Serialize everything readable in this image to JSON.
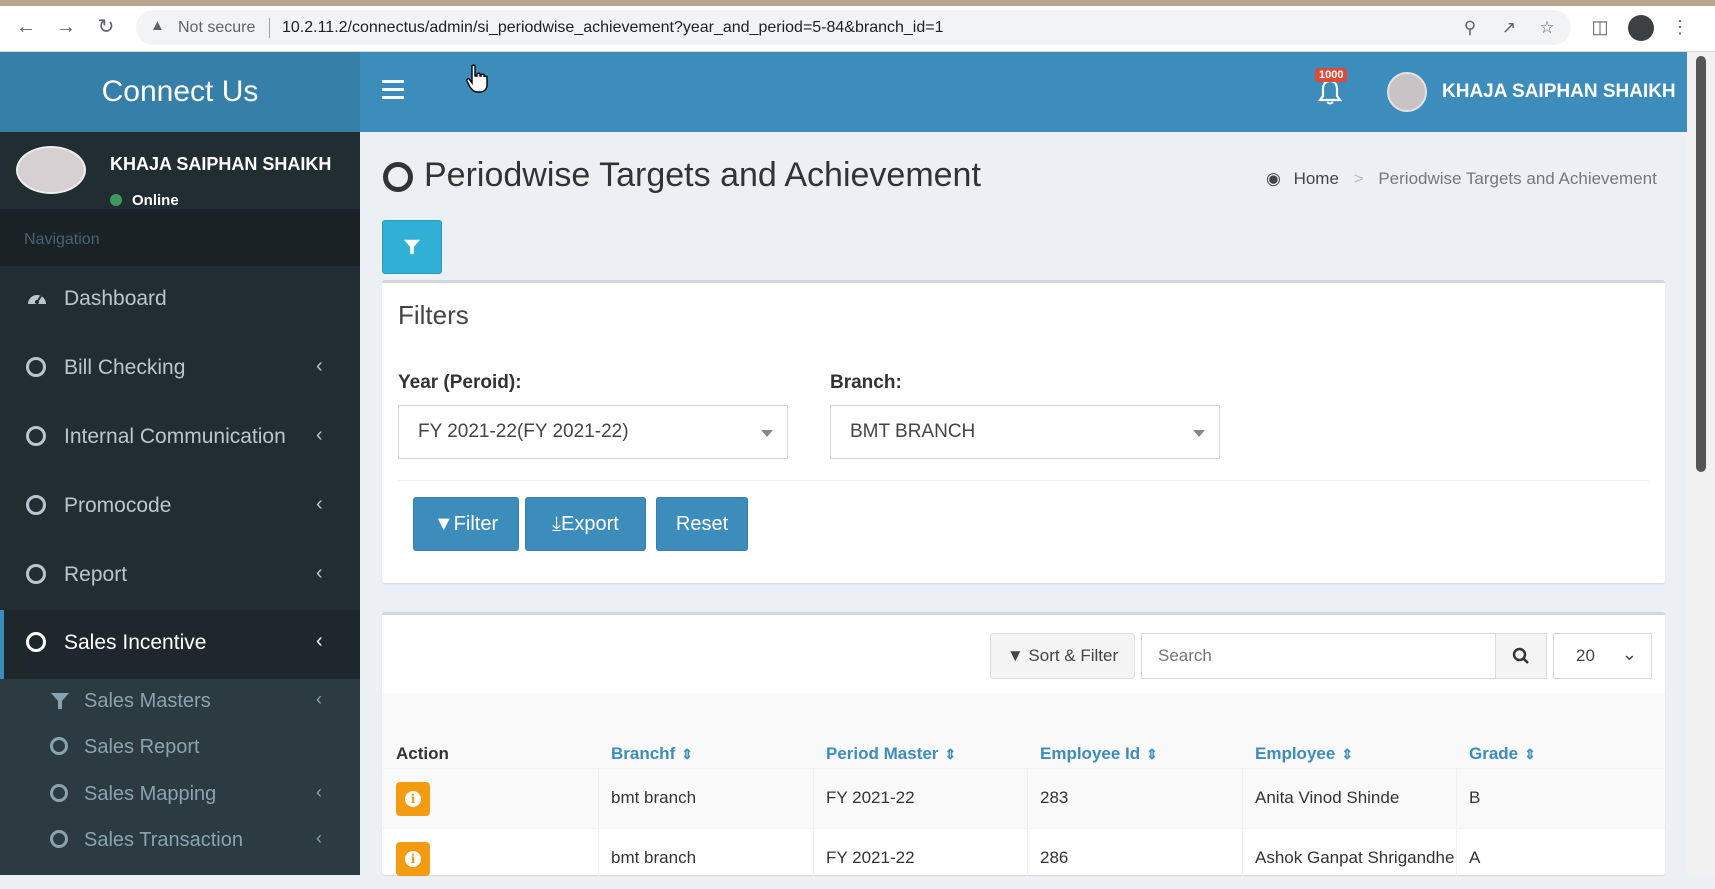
{
  "browser": {
    "not_secure": "Not secure",
    "url": "10.2.11.2/connectus/admin/si_periodwise_achievement?year_and_period=5-84&branch_id=1"
  },
  "app": {
    "logo": "Connect Us",
    "notification_count": "1000",
    "user_name": "KHAJA SAIPHAN SHAIKH"
  },
  "sidebar": {
    "user_name": "KHAJA SAIPHAN SHAIKH",
    "status": "Online",
    "nav_header": "Navigation",
    "items": [
      {
        "label": "Dashboard",
        "icon": "dashboard-icon"
      },
      {
        "label": "Bill Checking",
        "icon": "circle-icon"
      },
      {
        "label": "Internal Communication",
        "icon": "circle-icon"
      },
      {
        "label": "Promocode",
        "icon": "circle-icon"
      },
      {
        "label": "Report",
        "icon": "circle-icon"
      },
      {
        "label": "Sales Incentive",
        "icon": "circle-icon",
        "active": true
      }
    ],
    "sub_items": [
      {
        "label": "Sales Masters",
        "icon": "filter-icon"
      },
      {
        "label": "Sales Report",
        "icon": "circle-icon"
      },
      {
        "label": "Sales Mapping",
        "icon": "circle-icon"
      },
      {
        "label": "Sales Transaction",
        "icon": "circle-icon"
      }
    ]
  },
  "page": {
    "title": "Periodwise Targets and Achievement",
    "breadcrumb_home": "Home",
    "breadcrumb_current": "Periodwise Targets and Achievement"
  },
  "filters": {
    "title": "Filters",
    "year_label": "Year (Peroid):",
    "year_value": "FY 2021-22(FY 2021-22)",
    "branch_label": "Branch:",
    "branch_value": "BMT BRANCH",
    "filter_btn": "Filter",
    "export_btn": "Export",
    "reset_btn": "Reset"
  },
  "table": {
    "sort_filter": "Sort & Filter",
    "search_placeholder": "Search",
    "page_size": "20",
    "columns": [
      "Action",
      "Branchf",
      "Period Master",
      "Employee Id",
      "Employee",
      "Grade"
    ],
    "rows": [
      {
        "branch": "bmt branch",
        "period": "FY 2021-22",
        "emp_id": "283",
        "employee": "Anita Vinod Shinde",
        "grade": "B"
      },
      {
        "branch": "bmt branch",
        "period": "FY 2021-22",
        "emp_id": "286",
        "employee": "Ashok Ganpat Shrigandhe",
        "grade": "A"
      }
    ]
  },
  "colors": {
    "header": "#3c8dbc",
    "logo_bg": "#367fa9",
    "sidebar_bg": "#222d32",
    "info_btn": "#f39c12"
  }
}
